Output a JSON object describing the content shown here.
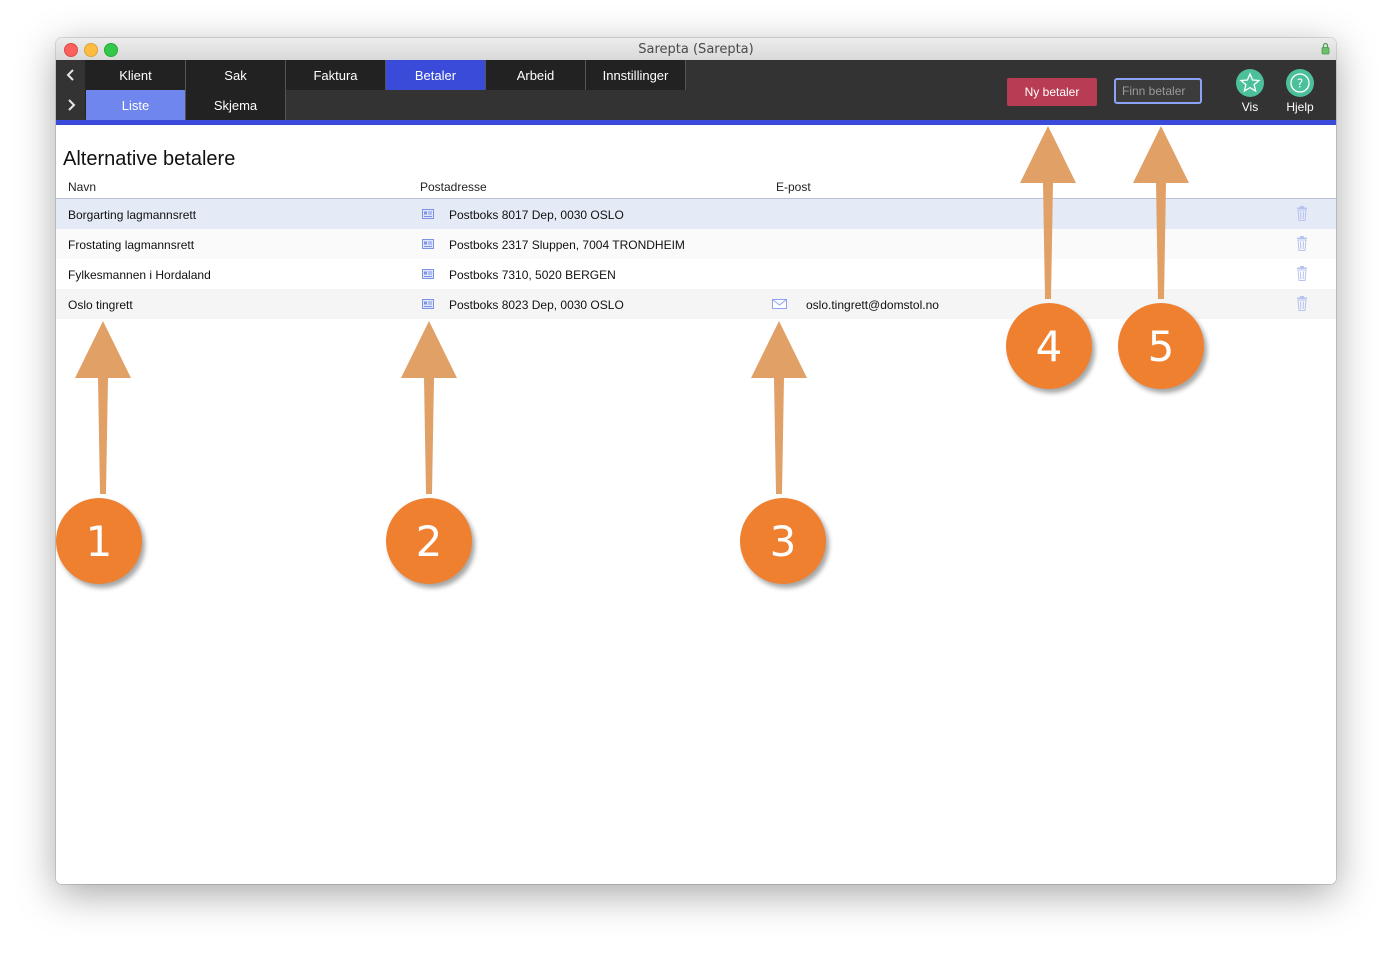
{
  "window": {
    "title": "Sarepta (Sarepta)"
  },
  "nav": {
    "tabs": [
      {
        "label": "Klient",
        "active": false
      },
      {
        "label": "Sak",
        "active": false
      },
      {
        "label": "Faktura",
        "active": false
      },
      {
        "label": "Betaler",
        "active": true
      },
      {
        "label": "Arbeid",
        "active": false
      },
      {
        "label": "Innstillinger",
        "active": false
      }
    ],
    "subtabs": [
      {
        "label": "Liste",
        "active": true
      },
      {
        "label": "Skjema",
        "active": false
      }
    ],
    "back_icon": "chevron-left-icon",
    "forward_icon": "chevron-right-icon"
  },
  "toolbar": {
    "new_button": "Ny betaler",
    "search_placeholder": "Finn betaler",
    "vis_label": "Vis",
    "hjelp_label": "Hjelp",
    "new_button_color": "#b83d54",
    "accent_color": "#3b4bd9",
    "tool_icon_color": "#4cc09a"
  },
  "main": {
    "title": "Alternative betalere",
    "columns": {
      "name": "Navn",
      "address": "Postadresse",
      "email": "E-post"
    },
    "rows": [
      {
        "name": "Borgarting lagmannsrett",
        "address": "Postboks 8017 Dep, 0030 OSLO",
        "email": ""
      },
      {
        "name": "Frostating lagmannsrett",
        "address": "Postboks 2317 Sluppen, 7004 TRONDHEIM",
        "email": ""
      },
      {
        "name": "Fylkesmannen i Hordaland",
        "address": "Postboks 7310, 5020 BERGEN",
        "email": ""
      },
      {
        "name": "Oslo tingrett",
        "address": "Postboks 8023 Dep, 0030 OSLO",
        "email": "oslo.tingrett@domstol.no"
      }
    ]
  },
  "annotations": {
    "markers": [
      "1",
      "2",
      "3",
      "4",
      "5"
    ],
    "marker_color": "#ef8030",
    "arrow_color": "#e0a066"
  }
}
